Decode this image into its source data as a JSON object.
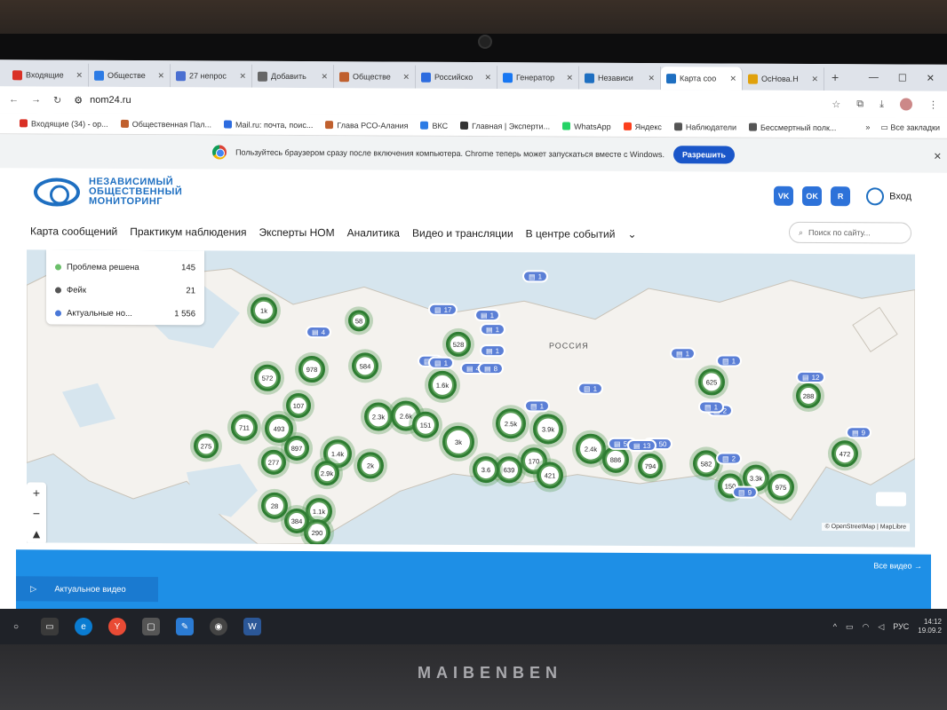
{
  "browser": {
    "tabs": [
      {
        "label": "Входящие",
        "color": "#d93025",
        "active": false
      },
      {
        "label": "Обществе",
        "color": "#2c7be5",
        "active": false
      },
      {
        "label": "27 непрос",
        "color": "#4a6fd1",
        "active": false
      },
      {
        "label": "Добавить",
        "color": "#666666",
        "active": false
      },
      {
        "label": "Обществе",
        "color": "#c0602e",
        "active": false
      },
      {
        "label": "Российско",
        "color": "#2d6cdf",
        "active": false
      },
      {
        "label": "Генератор",
        "color": "#1877f2",
        "active": false
      },
      {
        "label": "Независи",
        "color": "#1e6fc1",
        "active": false
      },
      {
        "label": "Карта соо",
        "color": "#1e6fc1",
        "active": true
      },
      {
        "label": "ОсНова.Н",
        "color": "#e0a10c",
        "active": false
      }
    ],
    "url": "nom24.ru",
    "bookmarks": [
      {
        "label": "Входящие (34) - ор...",
        "color": "#d93025"
      },
      {
        "label": "Общественная Пал...",
        "color": "#c0602e"
      },
      {
        "label": "Mail.ru: почта, поис...",
        "color": "#2d6cdf"
      },
      {
        "label": "Глава РСО-Алания",
        "color": "#c0602e"
      },
      {
        "label": "ВКС",
        "color": "#2c7be5"
      },
      {
        "label": "Главная | Эксперти...",
        "color": "#333333"
      },
      {
        "label": "WhatsApp",
        "color": "#25d366"
      },
      {
        "label": "Яндекс",
        "color": "#fc3f1d"
      },
      {
        "label": "Наблюдатели",
        "color": "#555555"
      },
      {
        "label": "Бессмертный полк...",
        "color": "#555555"
      }
    ],
    "bookmarks_more": "»",
    "all_bookmarks": "Все закладки"
  },
  "notification": {
    "text": "Пользуйтесь браузером сразу после включения компьютера. Chrome теперь может запускаться вместе с Windows.",
    "button": "Разрешить"
  },
  "site": {
    "logo_line1": "НЕЗАВИСИМЫЙ",
    "logo_line2": "ОБЩЕСТВЕННЫЙ",
    "logo_line3": "МОНИТОРИНГ",
    "social": [
      "VK",
      "OK",
      "R"
    ],
    "login": "Вход",
    "nav": [
      "Карта сообщений",
      "Практикум наблюдения",
      "Эксперты НОМ",
      "Аналитика",
      "Видео и трансляции",
      "В центре событий"
    ],
    "search_placeholder": "Поиск по сайту..."
  },
  "legend": {
    "rows": [
      {
        "label": "Проблема решена",
        "value": "145",
        "color": "#6bbf6a"
      },
      {
        "label": "Фейк",
        "value": "21",
        "color": "#555555"
      },
      {
        "label": "Актуальные но...",
        "value": "1 556",
        "color": "#4a78d8"
      }
    ]
  },
  "map": {
    "country_label": "РОССИЯ",
    "attribution": "© OpenStreetMap | MapLibre",
    "zoom_in": "+",
    "zoom_out": "−",
    "north": "▲",
    "clusters": [
      "1k",
      "58",
      "528",
      "572",
      "978",
      "584",
      "1.6k",
      "107",
      "711",
      "493",
      "2.3k",
      "2.6k",
      "151",
      "3k",
      "2.5k",
      "3.9k",
      "2k",
      "897",
      "1.4k",
      "2.9k",
      "277",
      "170",
      "639",
      "3.6",
      "421",
      "2.4k",
      "886",
      "794",
      "625",
      "582",
      "150",
      "3.3k",
      "975",
      "288",
      "472",
      "275",
      "1.1k",
      "290",
      "384",
      "28"
    ],
    "pills": [
      "1",
      "17",
      "1",
      "1",
      "4",
      "1",
      "1",
      "1",
      "4",
      "8",
      "1",
      "1",
      "1",
      "2",
      "50",
      "50",
      "13",
      "1",
      "2",
      "12",
      "9",
      "9",
      "1"
    ]
  },
  "video": {
    "all_videos": "Все видео →",
    "current": "Актуальное видео"
  },
  "taskbar": {
    "lang": "РУС",
    "time": "14:12",
    "date": "19.09.2"
  },
  "laptop_brand": "MAIBENBEN"
}
